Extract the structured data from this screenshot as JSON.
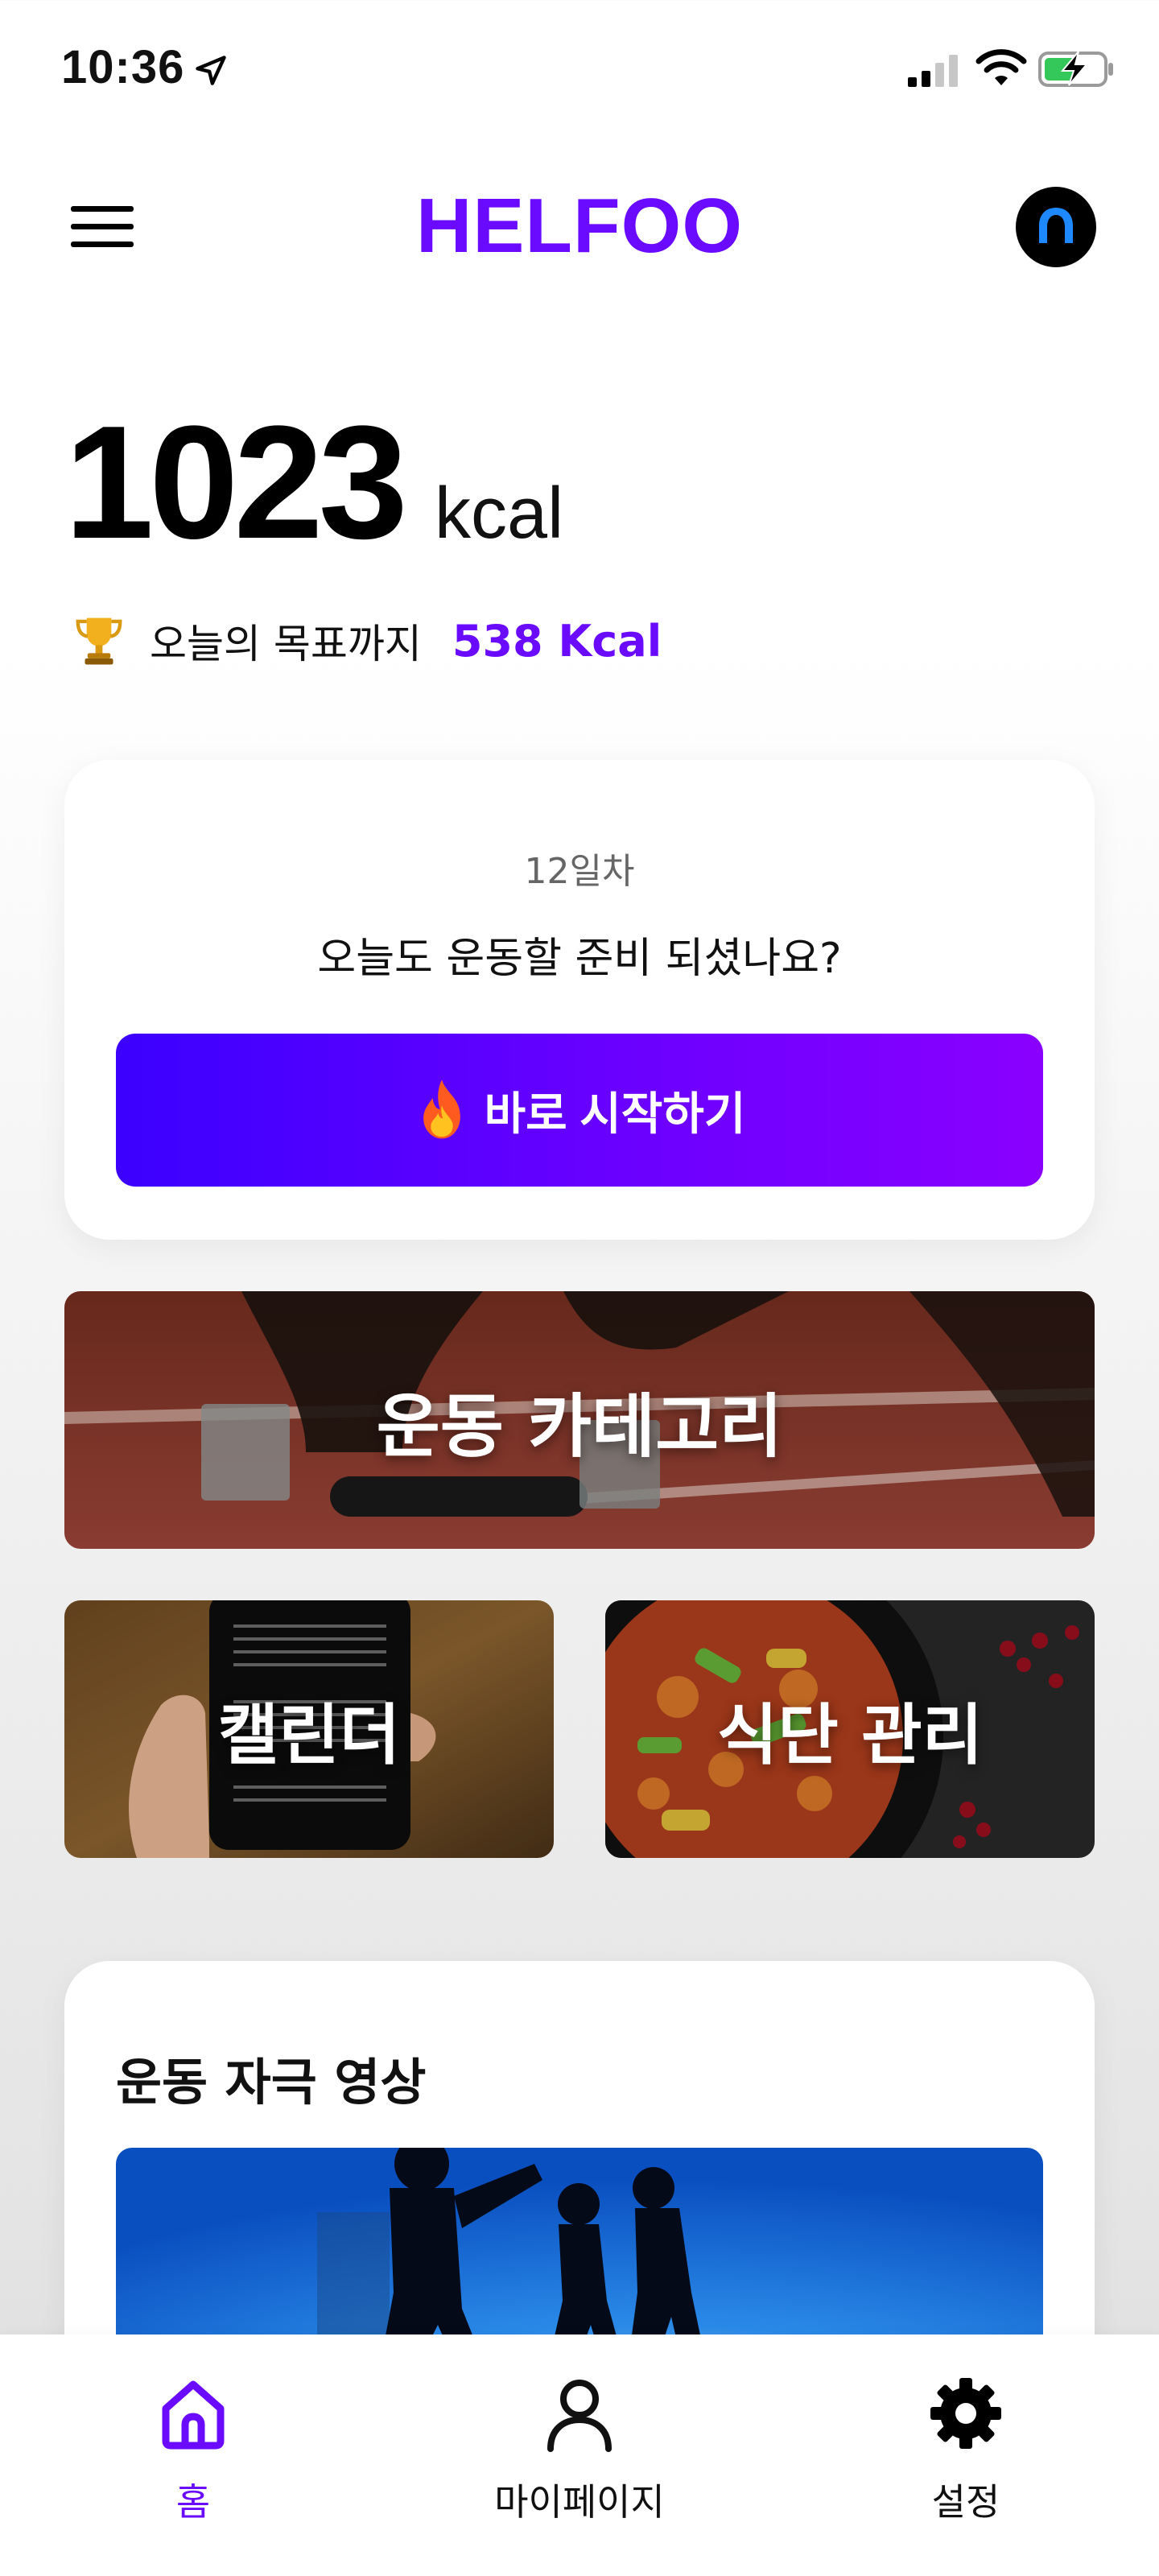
{
  "status_bar": {
    "time": "10:36"
  },
  "header": {
    "brand": "HELFOO",
    "icons": [
      "menu-icon",
      "avatar"
    ]
  },
  "summary": {
    "kcal_value": "1023",
    "kcal_unit": "kcal",
    "goal_label": "오늘의 목표까지",
    "goal_value": "538 Kcal",
    "goal_icon": "trophy-icon"
  },
  "start_card": {
    "day_count": "12일차",
    "prompt": "오늘도 운동할 준비 되셨나요?",
    "button_label": "바로 시작하기",
    "button_icon": "fire-icon"
  },
  "tiles": {
    "workout_category": "운동 카테고리",
    "calendar": "캘린더",
    "diet": "식단 관리"
  },
  "video_section": {
    "title": "운동 자극 영상"
  },
  "bottom_nav": {
    "items": [
      {
        "label": "홈",
        "icon": "home-icon",
        "active": true
      },
      {
        "label": "마이페이지",
        "icon": "user-icon",
        "active": false
      },
      {
        "label": "설정",
        "icon": "gear-icon",
        "active": false
      }
    ]
  },
  "colors": {
    "brand": "#6a0bff",
    "button_start": "#3b00ff",
    "button_end": "#8a00ff",
    "battery_fill": "#34c759"
  }
}
